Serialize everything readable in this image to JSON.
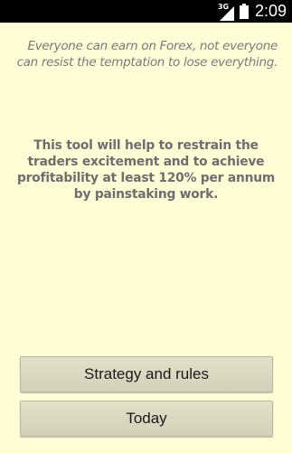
{
  "status_bar": {
    "network_type": "3G",
    "time": "2:09",
    "icons": [
      "signal-3g-icon",
      "battery-icon"
    ]
  },
  "content": {
    "tagline": "Everyone can earn on Forex, not everyone can resist the temptation to lose everything.",
    "description": "This tool will help to restrain the traders excitement and to achieve profitability at least 120% per annum by painstaking work."
  },
  "buttons": {
    "strategy_label": "Strategy and rules",
    "today_label": "Today"
  },
  "colors": {
    "background": "#fffdd6",
    "status_bar": "#000000",
    "button": "#d9d7c0",
    "text_muted": "#7a7a7a"
  }
}
